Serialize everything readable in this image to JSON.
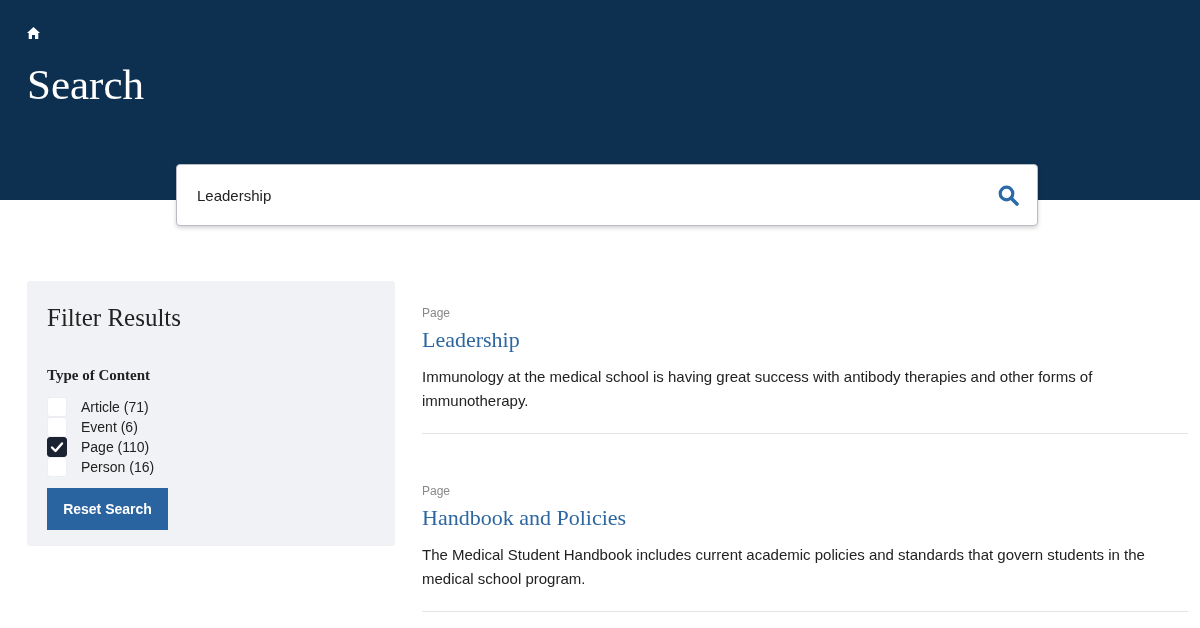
{
  "header": {
    "title": "Search"
  },
  "search": {
    "value": "Leadership"
  },
  "filters": {
    "title": "Filter Results",
    "group_title": "Type of Content",
    "options": [
      {
        "label": "Article (71)",
        "checked": false
      },
      {
        "label": "Event (6)",
        "checked": false
      },
      {
        "label": "Page (110)",
        "checked": true
      },
      {
        "label": "Person (16)",
        "checked": false
      }
    ],
    "reset_button": "Reset Search"
  },
  "results": [
    {
      "type": "Page",
      "title": "Leadership",
      "description": "Immunology at the medical school is having great success with antibody therapies and other forms of immunotherapy."
    },
    {
      "type": "Page",
      "title": "Handbook and Policies",
      "description": "The Medical Student Handbook includes current academic policies and standards that govern students in the medical school program."
    }
  ]
}
